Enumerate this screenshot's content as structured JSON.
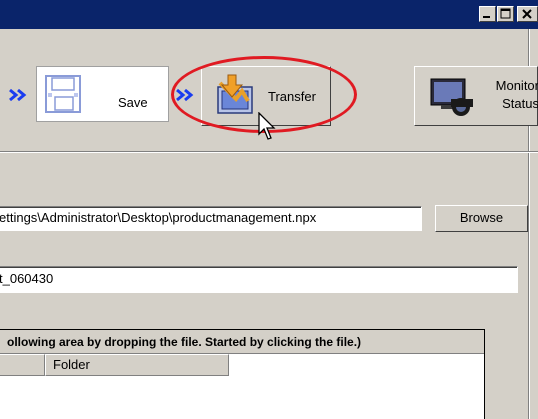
{
  "window": {
    "controls": {
      "minimize_icon": "minimize-icon",
      "maximize_icon": "maximize-icon",
      "close_icon": "close-icon"
    }
  },
  "toolbar": {
    "save_label": "Save",
    "transfer_label": "Transfer",
    "monitor_status_line1": "Monitor",
    "monitor_status_line2": "Status"
  },
  "form": {
    "path_value": "ettings\\Administrator\\Desktop\\productmanagement.npx",
    "browse_label": "Browse",
    "name_value": "t_060430"
  },
  "drop_area": {
    "title": "ollowing area by dropping the file. Started by clicking the file.)",
    "columns": [
      "",
      "Folder"
    ]
  },
  "colors": {
    "title_bar": "#0a246a",
    "highlight": "#e01a22",
    "chevron": "#1a3cf0",
    "face": "#d4d0c8"
  }
}
